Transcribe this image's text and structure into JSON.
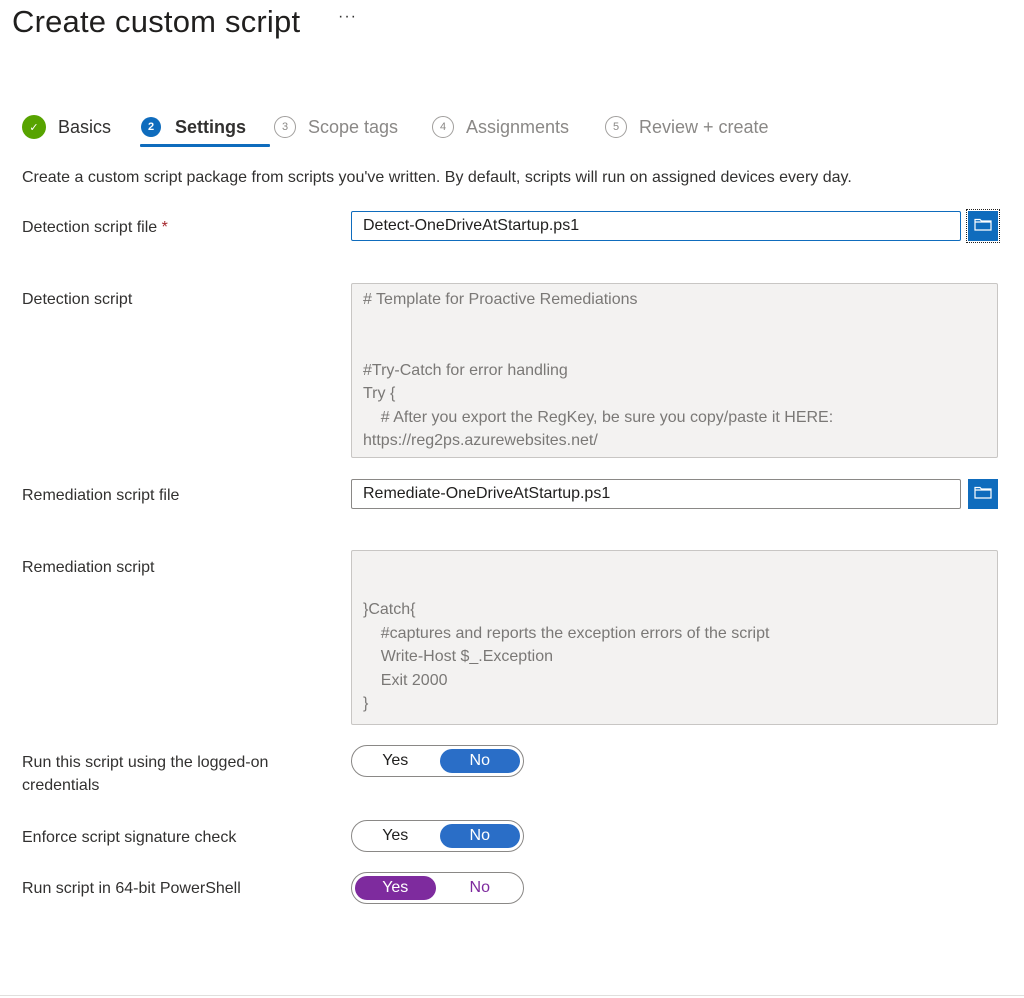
{
  "page": {
    "title": "Create custom script",
    "more_label": "···"
  },
  "steps": [
    {
      "number": "✓",
      "label": "Basics",
      "state": "done"
    },
    {
      "number": "2",
      "label": "Settings",
      "state": "active"
    },
    {
      "number": "3",
      "label": "Scope tags",
      "state": "future"
    },
    {
      "number": "4",
      "label": "Assignments",
      "state": "future"
    },
    {
      "number": "5",
      "label": "Review + create",
      "state": "future"
    }
  ],
  "description": "Create a custom script package from scripts you've written. By default, scripts will run on assigned devices every day.",
  "detection_file": {
    "label": "Detection script file",
    "required_mark": "*",
    "value": "Detect-OneDriveAtStartup.ps1",
    "browse_icon": "folder-icon"
  },
  "detection_script": {
    "label": "Detection script",
    "content": "# Template for Proactive Remediations\n\n\n#Try-Catch for error handling\nTry {\n    # After you export the RegKey, be sure you copy/paste it HERE:\nhttps://reg2ps.azurewebsites.net/"
  },
  "remediation_file": {
    "label": "Remediation script file",
    "value": "Remediate-OneDriveAtStartup.ps1",
    "browse_icon": "folder-icon"
  },
  "remediation_script": {
    "label": "Remediation script",
    "content": "\n\n}Catch{\n    #captures and reports the exception errors of the script\n    Write-Host $_.Exception\n    Exit 2000\n}"
  },
  "options": [
    {
      "label": "Run this script using the logged-on credentials",
      "yes": "Yes",
      "no": "No",
      "selected": "No"
    },
    {
      "label": "Enforce script signature check",
      "yes": "Yes",
      "no": "No",
      "selected": "No"
    },
    {
      "label": "Run script in 64-bit PowerShell",
      "yes": "Yes",
      "no": "No",
      "selected": "Yes"
    }
  ],
  "colors": {
    "accent": "#0f6cbd",
    "toggle_blue": "#2a6ec7",
    "toggle_purple": "#7e2b9e",
    "success": "#57a300",
    "required": "#a4262c"
  }
}
